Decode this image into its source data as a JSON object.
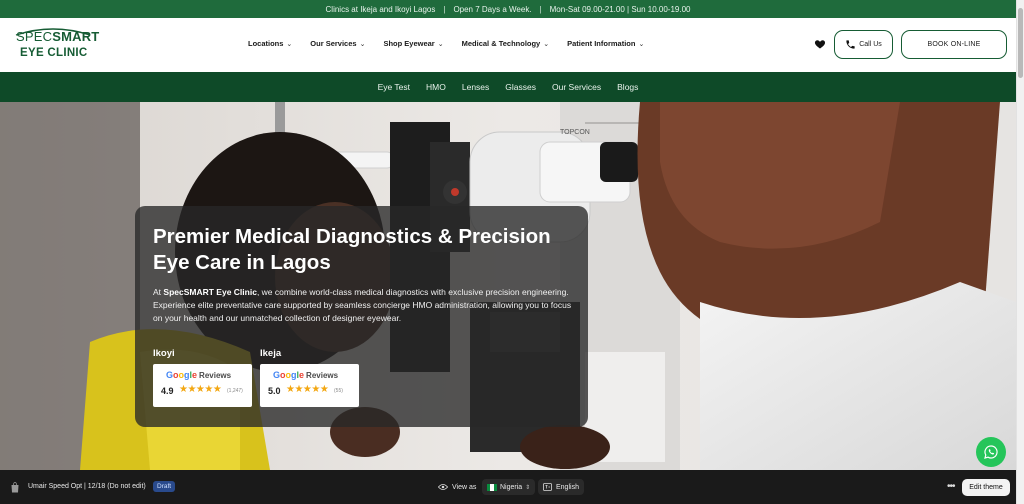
{
  "announcement": {
    "clinics": "Clinics at Ikeja and Ikoyi Lagos",
    "separator": "|",
    "open_days": "Open 7 Days a Week.",
    "hours": "Mon-Sat 09.00-21.00 | Sun 10.00-19.00"
  },
  "header": {
    "logo_line1_a": "SPEC",
    "logo_line1_b": "SMART",
    "logo_line2": "EYE CLINIC",
    "nav": [
      {
        "label": "Locations"
      },
      {
        "label": "Our Services"
      },
      {
        "label": "Shop Eyewear"
      },
      {
        "label": "Medical & Technology"
      },
      {
        "label": "Patient Information"
      }
    ],
    "call_label": "Call Us",
    "book_label": "BOOK ON-LINE"
  },
  "subnav": [
    {
      "label": "Eye Test"
    },
    {
      "label": "HMO"
    },
    {
      "label": "Lenses"
    },
    {
      "label": "Glasses"
    },
    {
      "label": "Our Services"
    },
    {
      "label": "Blogs"
    }
  ],
  "hero": {
    "title": "Premier Medical Diagnostics & Precision Eye Care in Lagos",
    "desc_prefix": "At ",
    "desc_brand": "SpecSMART Eye Clinic",
    "desc_rest": ", we combine world-class medical diagnostics with exclusive precision engineering. Experience elite preventative care supported by seamless concierge HMO administration, allowing you to focus on your health and our unmatched collection of designer eyewear.",
    "photo_text": "TOPCON",
    "reviews": [
      {
        "location": "Ikoyi",
        "google": "Google",
        "reviews_word": "Reviews",
        "score": "4.9",
        "stars": "★★★★★",
        "count": "(1,247)"
      },
      {
        "location": "Ikeja",
        "google": "Google",
        "reviews_word": "Reviews",
        "score": "5.0",
        "stars": "★★★★★",
        "count": "(55)"
      }
    ]
  },
  "theme_bar": {
    "store_name": "Umair Speed Opt | 12/18 (Do not edit)",
    "draft_badge": "Draft",
    "view_as": "View as",
    "country": "Nigeria",
    "language": "English",
    "edit_theme": "Edit theme"
  },
  "colors": {
    "brand_green": "#165c34",
    "announce_green": "#1f6b3c",
    "subnav_green": "#0e4a28",
    "whatsapp_green": "#25c55a"
  }
}
